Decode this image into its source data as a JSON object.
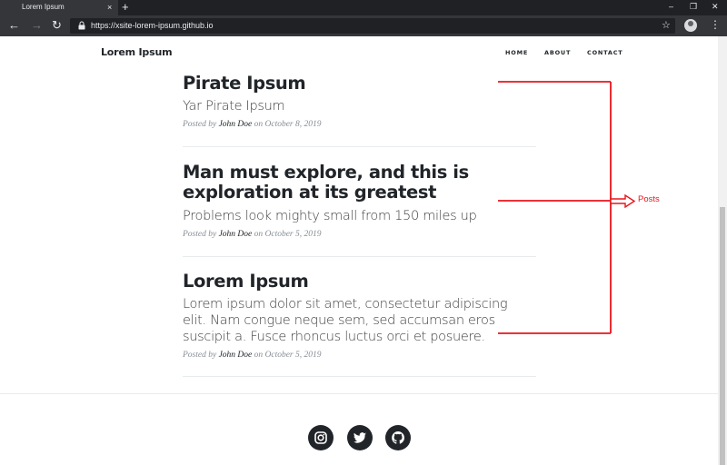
{
  "browser": {
    "tab_title": "Lorem Ipsum",
    "tab_close": "×",
    "new_tab": "+",
    "back": "←",
    "forward": "→",
    "reload": "↻",
    "url": "https://xsite-lorem-ipsum.github.io",
    "bookmark": "☆",
    "menu": "⋮",
    "minimize": "–",
    "restore": "❐",
    "close": "✕"
  },
  "site": {
    "brand": "Lorem Ipsum",
    "nav": [
      {
        "label": "HOME"
      },
      {
        "label": "ABOUT"
      },
      {
        "label": "CONTACT"
      }
    ]
  },
  "posts": [
    {
      "title": "Pirate Ipsum",
      "subtitle": "Yar Pirate Ipsum",
      "meta_prefix": "Posted by",
      "author": "John Doe",
      "meta_on": "on",
      "date": "October 8, 2019"
    },
    {
      "title": "Man must explore, and this is exploration at its greatest",
      "subtitle": "Problems look mighty small from 150 miles up",
      "meta_prefix": "Posted by",
      "author": "John Doe",
      "meta_on": "on",
      "date": "October 5, 2019"
    },
    {
      "title": "Lorem Ipsum",
      "subtitle": "Lorem ipsum dolor sit amet, consectetur adipiscing elit. Nam congue neque sem, sed accumsan eros suscipit a. Fusce rhoncus luctus orci et posuere.",
      "meta_prefix": "Posted by",
      "author": "John Doe",
      "meta_on": "on",
      "date": "October 5, 2019"
    }
  ],
  "footer": {
    "social": [
      "instagram-icon",
      "twitter-icon",
      "github-icon"
    ]
  },
  "annotation": {
    "label": "Posts",
    "color": "#e8141b"
  }
}
